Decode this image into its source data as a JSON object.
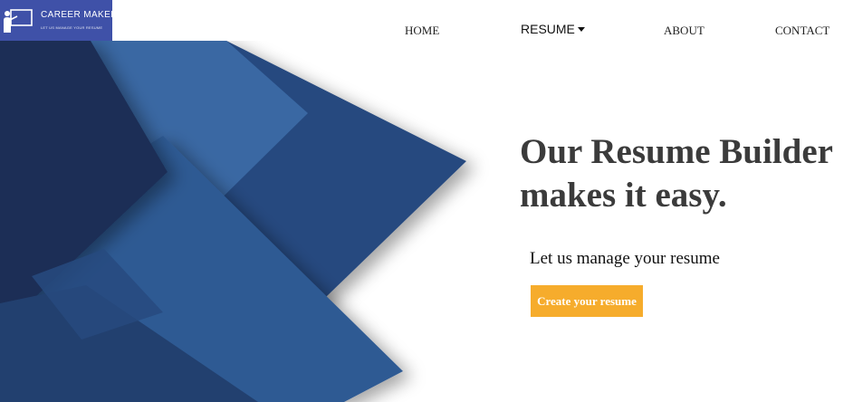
{
  "header": {
    "logo": {
      "name": "CAREER MAKER",
      "tagline": "LET US MANAGE YOUR RESUME",
      "icon": "presenter-board-icon",
      "background": "#3f51a8"
    },
    "nav": {
      "home": "HOME",
      "resume": "RESUME",
      "about": "ABOUT",
      "contact": "CONTACT"
    }
  },
  "hero": {
    "headline_line1": "Our Resume Builder",
    "headline_line2": "makes it easy.",
    "subheadline": "Let us manage your resume",
    "cta_label": "Create your resume",
    "cta_color": "#f6ac2c",
    "art_colors": [
      "#1b2f56",
      "#274a7f",
      "#2f5a93",
      "#3a68a3"
    ]
  }
}
